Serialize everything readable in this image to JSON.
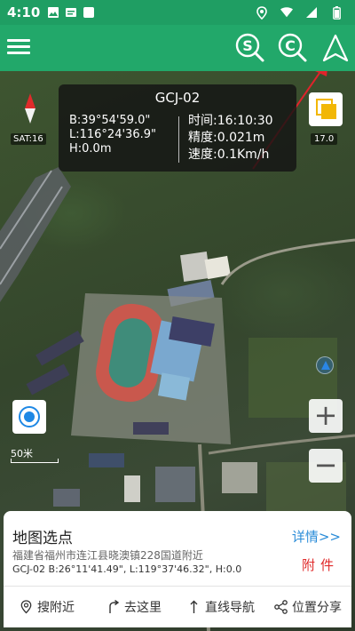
{
  "status_bar": {
    "time": "4:10",
    "icons": [
      "image-icon",
      "notification-icon",
      "app-icon",
      "location-icon",
      "wifi-icon",
      "signal-icon",
      "battery-icon"
    ]
  },
  "app_bar": {
    "accent_color": "#22a86a",
    "buttons": [
      "menu-icon",
      "search-s-icon",
      "search-c-icon",
      "navigation-arrow-icon"
    ]
  },
  "info_panel": {
    "title": "GCJ-02",
    "lat": "B:39°54'59.0\"",
    "lng": "L:116°24'36.9\"",
    "height": "H:0.0m",
    "time": "时间:16:10:30",
    "accuracy": "精度:0.021m",
    "speed": "速度:0.1Km/h"
  },
  "map": {
    "sat": "SAT:16",
    "zoom_level": "17.0",
    "scale": "50米",
    "zoom_in": "+",
    "zoom_out": "−"
  },
  "sheet": {
    "title": "地图选点",
    "details": "详情>>",
    "address": "福建省福州市连江县晓澳镇228国道附近",
    "attachment": "附件",
    "coords": "GCJ-02  B:26°11'41.49\", L:119°37'46.32\", H:0.0",
    "actions": [
      {
        "label": "搜附近",
        "icon": "location-pin-icon"
      },
      {
        "label": "去这里",
        "icon": "turn-arrow-icon"
      },
      {
        "label": "直线导航",
        "icon": "straight-arrow-icon"
      },
      {
        "label": "位置分享",
        "icon": "share-icon"
      }
    ]
  }
}
